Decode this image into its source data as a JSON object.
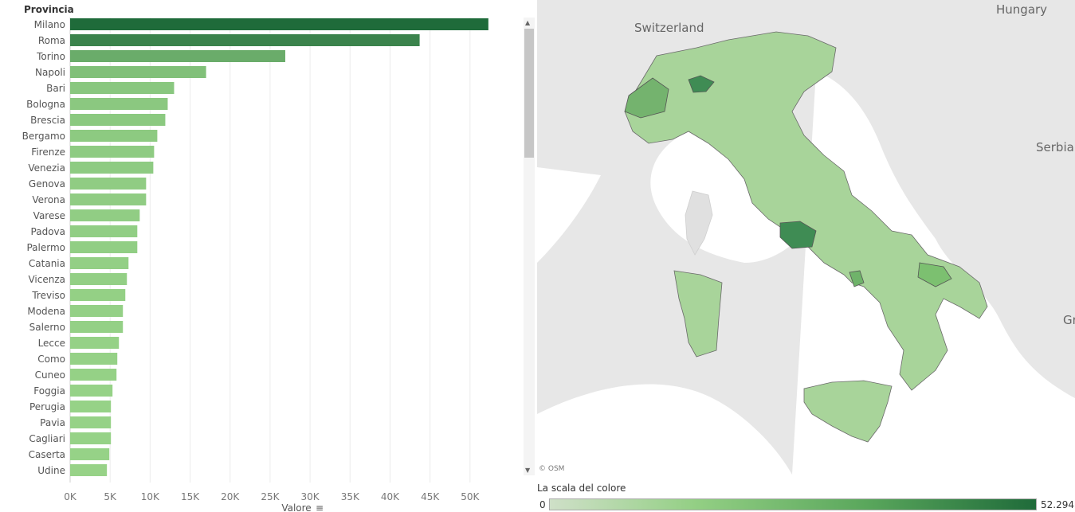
{
  "colors": {
    "bar_dark": "#1f6b3a",
    "bar_light": "#9bd68a",
    "grid": "#ececec",
    "sea": "#ffffff",
    "land": "#e3e3e3",
    "province": "#a8d49a",
    "province_dark": "#3f8c54"
  },
  "chart_data": {
    "type": "bar",
    "orientation": "horizontal",
    "row_header": "Provincia",
    "xlabel": "Valore",
    "categories": [
      "Milano",
      "Roma",
      "Torino",
      "Napoli",
      "Bari",
      "Bologna",
      "Brescia",
      "Bergamo",
      "Firenze",
      "Venezia",
      "Genova",
      "Verona",
      "Varese",
      "Padova",
      "Palermo",
      "Catania",
      "Vicenza",
      "Treviso",
      "Modena",
      "Salerno",
      "Lecce",
      "Como",
      "Cuneo",
      "Foggia",
      "Perugia",
      "Pavia",
      "Cagliari",
      "Caserta",
      "Udine"
    ],
    "values": [
      52294,
      43700,
      26900,
      17000,
      13000,
      12200,
      11900,
      10900,
      10500,
      10400,
      9500,
      9500,
      8700,
      8400,
      8400,
      7300,
      7100,
      6900,
      6600,
      6600,
      6100,
      5900,
      5800,
      5300,
      5100,
      5100,
      5100,
      4900,
      4600
    ],
    "xlim": [
      0,
      55000
    ],
    "ticks": [
      0,
      5000,
      10000,
      15000,
      20000,
      25000,
      30000,
      35000,
      40000,
      45000,
      50000
    ],
    "tick_labels": [
      "0K",
      "5K",
      "10K",
      "15K",
      "20K",
      "25K",
      "30K",
      "35K",
      "40K",
      "45K",
      "50K"
    ],
    "grid": true
  },
  "map": {
    "country_labels": [
      "Switzerland",
      "Hungary",
      "Serbia",
      "Gr"
    ],
    "attribution": "© OSM"
  },
  "legend": {
    "title": "La scala del colore",
    "min": "0",
    "max": "52.294"
  }
}
